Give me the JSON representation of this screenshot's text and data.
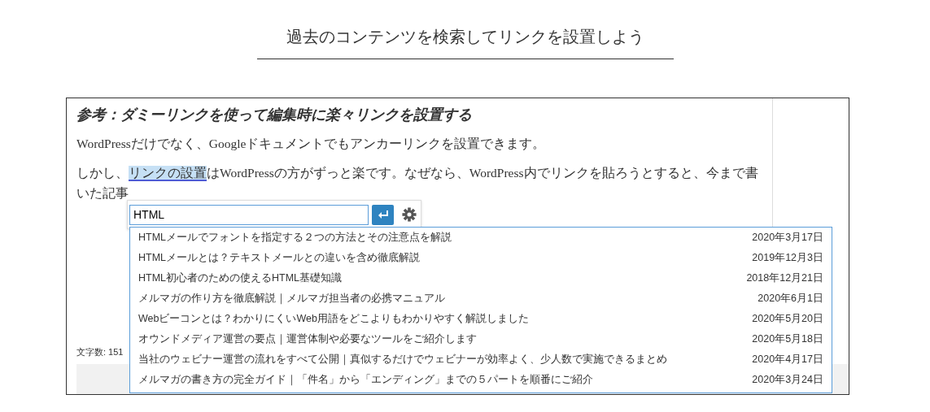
{
  "page_title": "過去のコンテンツを検索してリンクを設置しよう",
  "editor": {
    "heading": "参考：ダミーリンクを使って編集時に楽々リンクを設置する",
    "paragraph_1": "WordPressだけでなく、Googleドキュメントでもアンカーリンクを設置できます。",
    "paragraph_2": {
      "text_before": "しかし、",
      "selected_text": "リンクの設置",
      "text_after": "はWordPressの方がずっと楽です。なぜなら、WordPress内でリンクを貼ろうとすると、今まで書"
    },
    "paragraph_3": "いた記事",
    "word_count": "文字数: 151"
  },
  "link_popup": {
    "value": "HTML",
    "results": [
      {
        "title": "HTMLメールでフォントを指定する２つの方法とその注意点を解説",
        "date": "2020年3月17日"
      },
      {
        "title": "HTMLメールとは？テキストメールとの違いを含め徹底解説",
        "date": "2019年12月3日"
      },
      {
        "title": "HTML初心者のための使えるHTML基礎知識",
        "date": "2018年12月21日"
      },
      {
        "title": "メルマガの作り方を徹底解説｜メルマガ担当者の必携マニュアル",
        "date": "2020年6月1日"
      },
      {
        "title": "Webビーコンとは？わかりにくいWeb用語をどこよりもわかりやすく解説しました",
        "date": "2020年5月20日"
      },
      {
        "title": "オウンドメディア運営の要点｜運営体制や必要なツールをご紹介します",
        "date": "2020年5月18日"
      },
      {
        "title": "当社のウェビナー運営の流れをすべて公開｜真似するだけでウェビナーが効率よく、少人数で実施できるまとめ",
        "date": "2020年4月17日"
      },
      {
        "title": "メルマガの書き方の完全ガイド｜「件名」から「エンディング」までの５パートを順番にご紹介",
        "date": "2020年3月24日"
      }
    ]
  }
}
